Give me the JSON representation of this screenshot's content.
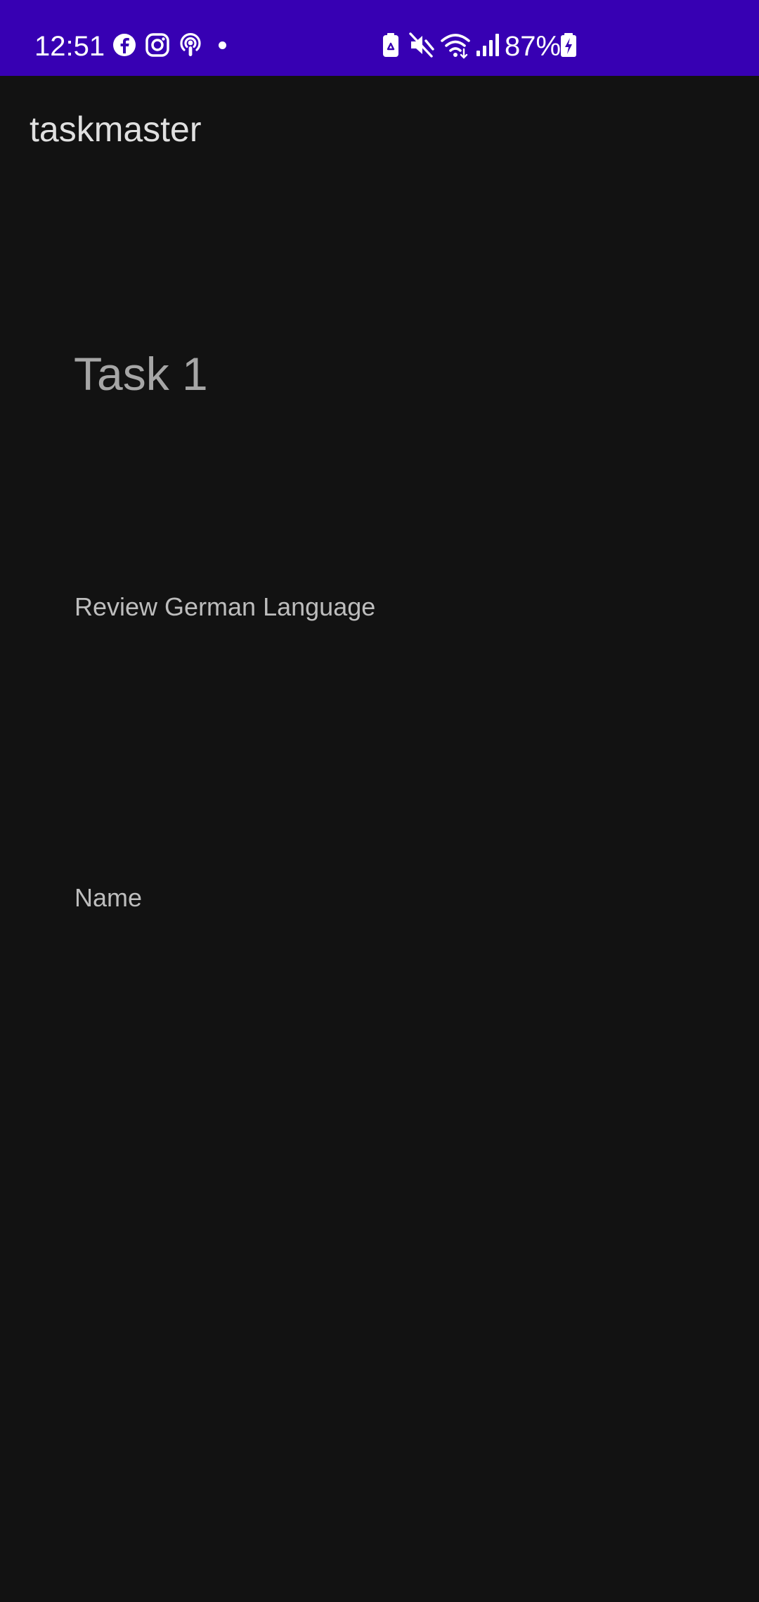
{
  "status_bar": {
    "time": "12:51",
    "battery_percent": "87%",
    "background_color": "#3700b3",
    "left_icons": [
      "facebook-icon",
      "instagram-icon",
      "podcast-icon",
      "notification-dot"
    ],
    "right_icons": [
      "battery-saver-icon",
      "mute-icon",
      "wifi-icon",
      "signal-icon",
      "battery-charging-icon"
    ]
  },
  "app": {
    "title": "taskmaster"
  },
  "task": {
    "title": "Task 1",
    "description": "Review German Language",
    "name": "Name"
  }
}
